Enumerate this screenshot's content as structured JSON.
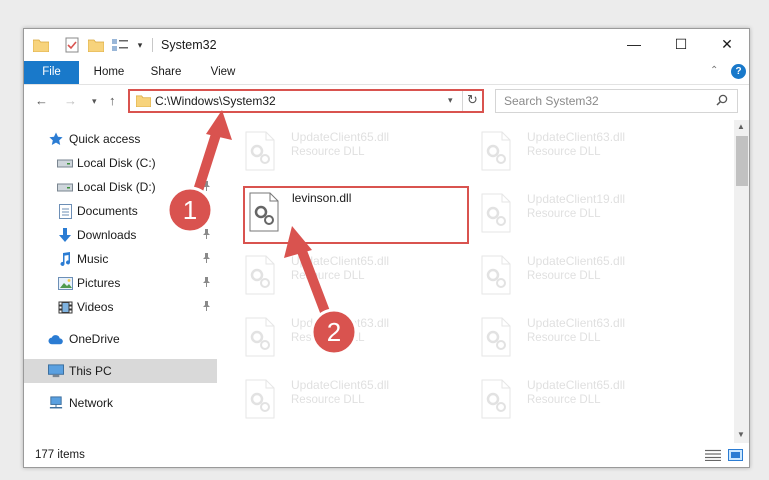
{
  "window": {
    "title": "System32",
    "controls": {
      "minimize": "—",
      "maximize": "☐",
      "close": "✕"
    }
  },
  "quick_access_toolbar": {
    "dropdown_glyph": "▾"
  },
  "ribbon": {
    "tabs": [
      {
        "label": "File",
        "active": true
      },
      {
        "label": "Home"
      },
      {
        "label": "Share"
      },
      {
        "label": "View"
      }
    ],
    "collapse_glyph": "⌃",
    "help_glyph": "?"
  },
  "nav": {
    "back_glyph": "←",
    "forward_glyph": "→",
    "recent_glyph": "▾",
    "up_glyph": "↑",
    "address": "C:\\Windows\\System32",
    "address_dropdown_glyph": "▾",
    "refresh_glyph": "↻",
    "search_placeholder": "Search System32",
    "search_glyph": "⚲"
  },
  "sidebar": {
    "items": [
      {
        "label": "Quick access",
        "icon": "star-icon"
      },
      {
        "label": "Local Disk (C:)",
        "icon": "drive-icon",
        "pinned": true
      },
      {
        "label": "Local Disk (D:)",
        "icon": "drive-icon",
        "pinned": true
      },
      {
        "label": "Documents",
        "icon": "documents-icon",
        "pinned": true
      },
      {
        "label": "Downloads",
        "icon": "download-icon",
        "pinned": true
      },
      {
        "label": "Music",
        "icon": "music-icon",
        "pinned": true
      },
      {
        "label": "Pictures",
        "icon": "pictures-icon",
        "pinned": true
      },
      {
        "label": "Videos",
        "icon": "video-icon",
        "pinned": true
      },
      {
        "label": "OneDrive",
        "icon": "cloud-icon"
      },
      {
        "label": "This PC",
        "icon": "computer-icon",
        "selected": true
      },
      {
        "label": "Network",
        "icon": "network-icon"
      }
    ],
    "pin_glyph": "📌"
  },
  "files": [
    {
      "name": "UpdateClient65.dll",
      "type": "Resource DLL",
      "faded": true
    },
    {
      "name": "UpdateClient63.dll",
      "type": "Resource DLL",
      "faded": true
    },
    {
      "name": "levinson.dll",
      "type": "",
      "highlight": true
    },
    {
      "name": "UpdateClient19.dll",
      "type": "Resource DLL",
      "faded": true
    },
    {
      "name": "UpdateClient65.dll",
      "type": "Resource DLL",
      "faded": true
    },
    {
      "name": "UpdateClient65.dll",
      "type": "Resource DLL",
      "faded": true
    },
    {
      "name": "UpdateClient63.dll",
      "type": "Resource DLL",
      "faded": true
    },
    {
      "name": "UpdateClient63.dll",
      "type": "Resource DLL",
      "faded": true
    },
    {
      "name": "UpdateClient65.dll",
      "type": "Resource DLL",
      "faded": true
    },
    {
      "name": "UpdateClient65.dll",
      "type": "Resource DLL",
      "faded": true
    }
  ],
  "scrollbar": {
    "up_glyph": "▲",
    "down_glyph": "▼"
  },
  "status": {
    "item_count": "177 items"
  },
  "annotations": {
    "marker_1": "1",
    "marker_2": "2",
    "color": "#d9534f"
  },
  "colors": {
    "accent": "#1979ca",
    "highlight_border": "#d9534f",
    "selected_bg": "#d9d9d9"
  }
}
